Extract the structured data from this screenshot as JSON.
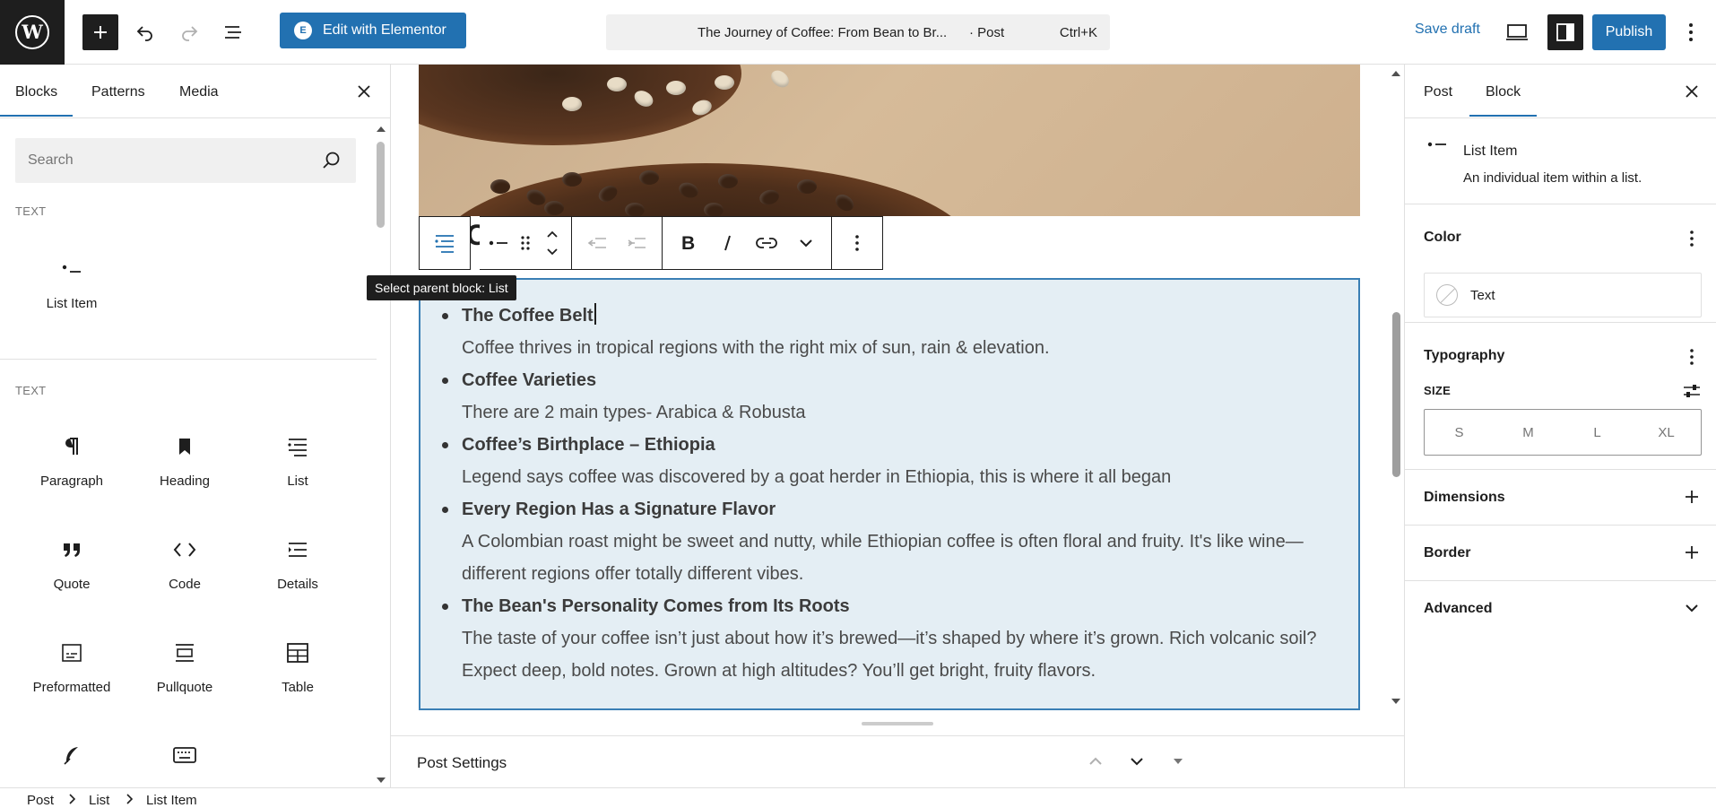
{
  "topbar": {
    "elementor_label": "Edit with Elementor",
    "command_title": "The Journey of Coffee: From Bean to Br...",
    "command_type": "· Post",
    "command_shortcut": "Ctrl+K",
    "save_draft_label": "Save draft",
    "publish_label": "Publish"
  },
  "inserter": {
    "tabs": [
      "Blocks",
      "Patterns",
      "Media"
    ],
    "search_placeholder": "Search",
    "section1_label": "TEXT",
    "section1_items": [
      "List Item"
    ],
    "section2_label": "TEXT",
    "section2_items": [
      "Paragraph",
      "Heading",
      "List",
      "Quote",
      "Code",
      "Details",
      "Preformatted",
      "Pullquote",
      "Table"
    ]
  },
  "editor": {
    "tooltip": "Select parent block: List",
    "list_items": [
      {
        "title": "The Coffee Belt",
        "desc": "Coffee thrives in tropical regions with the right mix of sun, rain & elevation."
      },
      {
        "title": "Coffee Varieties",
        "desc": "There are 2 main types- Arabica & Robusta"
      },
      {
        "title": "Coffee’s Birthplace – Ethiopia",
        "desc": "Legend says coffee was discovered by a goat herder in Ethiopia, this is where it all began"
      },
      {
        "title": "Every Region Has a Signature Flavor",
        "desc": "A Colombian roast might be sweet and nutty, while Ethiopian coffee is often floral and fruity. It's like wine—different regions offer totally different vibes."
      },
      {
        "title": "The Bean's Personality Comes from Its Roots",
        "desc": "The taste of your coffee isn’t just about how it’s brewed—it’s shaped by where it’s grown. Rich volcanic soil? Expect deep, bold notes. Grown at high altitudes? You’ll get bright, fruity flavors."
      }
    ],
    "post_settings_label": "Post Settings"
  },
  "sidebar": {
    "tabs": [
      "Post",
      "Block"
    ],
    "block_name": "List Item",
    "block_desc": "An individual item within a list.",
    "color_title": "Color",
    "color_item": "Text",
    "typography_title": "Typography",
    "size_label": "SIZE",
    "size_options": [
      "S",
      "M",
      "L",
      "XL"
    ],
    "dimensions_title": "Dimensions",
    "border_title": "Border",
    "advanced_title": "Advanced"
  },
  "breadcrumb": [
    "Post",
    "List",
    "List Item"
  ],
  "colors": {
    "accent": "#2271b1",
    "dark": "#1e1e1e",
    "selected_block_bg": "#e4eef4"
  }
}
